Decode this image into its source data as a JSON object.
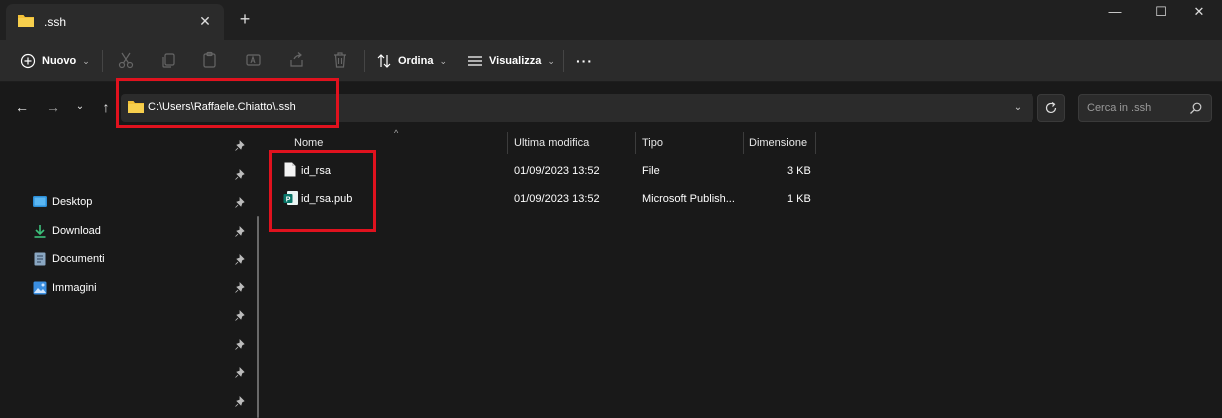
{
  "window": {
    "tab_title": ".ssh",
    "tab_close": "✕",
    "new_tab": "+",
    "minimize": "—",
    "maximize": "☐",
    "close": "✕"
  },
  "toolbar": {
    "new_label": "Nuovo",
    "sort_label": "Ordina",
    "view_label": "Visualizza",
    "more_label": "···"
  },
  "address": {
    "path": "C:\\Users\\Raffaele.Chiatto\\.ssh"
  },
  "search": {
    "placeholder": "Cerca in .ssh"
  },
  "sidebar": {
    "items": [
      {
        "label": "Desktop"
      },
      {
        "label": "Download"
      },
      {
        "label": "Documenti"
      },
      {
        "label": "Immagini"
      }
    ]
  },
  "columns": {
    "name": "Nome",
    "modified": "Ultima modifica",
    "type": "Tipo",
    "size": "Dimensione"
  },
  "files": [
    {
      "name": "id_rsa",
      "modified": "01/09/2023 13:52",
      "type": "File",
      "size": "3 KB",
      "icon": "file-icon"
    },
    {
      "name": "id_rsa.pub",
      "modified": "01/09/2023 13:52",
      "type": "Microsoft Publish...",
      "size": "1 KB",
      "icon": "publisher-icon"
    }
  ],
  "colors": {
    "highlight": "#e0121e",
    "folder": "#f2c037",
    "background": "#191919"
  }
}
